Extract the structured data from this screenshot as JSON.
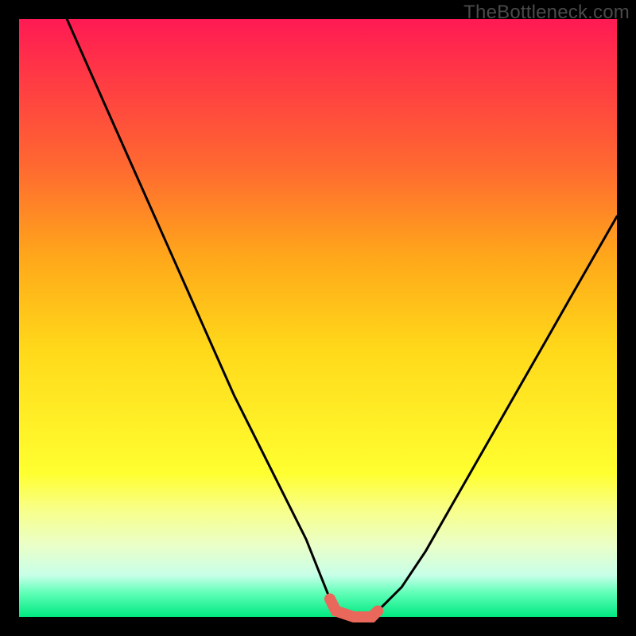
{
  "attribution": "TheBottleneck.com",
  "colors": {
    "highlight_stroke": "#e9675b",
    "curve_stroke": "#000000"
  },
  "chart_data": {
    "type": "line",
    "title": "",
    "xlabel": "",
    "ylabel": "",
    "xlim": [
      0,
      100
    ],
    "ylim": [
      0,
      100
    ],
    "series": [
      {
        "name": "bottleneck-curve",
        "x": [
          8,
          12,
          16,
          20,
          24,
          28,
          32,
          36,
          40,
          44,
          48,
          52,
          53,
          56,
          59,
          60,
          64,
          68,
          72,
          76,
          80,
          84,
          88,
          92,
          96,
          100
        ],
        "y": [
          100,
          91,
          82,
          73,
          64,
          55,
          46,
          37,
          29,
          21,
          13,
          3,
          1,
          0,
          0,
          1,
          5,
          11,
          18,
          25,
          32,
          39,
          46,
          53,
          60,
          67
        ]
      }
    ],
    "highlight_segment": {
      "series": "bottleneck-curve",
      "x_start": 52,
      "x_end": 60,
      "description": "flat optimal zone near bottom"
    },
    "grid": false,
    "legend": false
  }
}
